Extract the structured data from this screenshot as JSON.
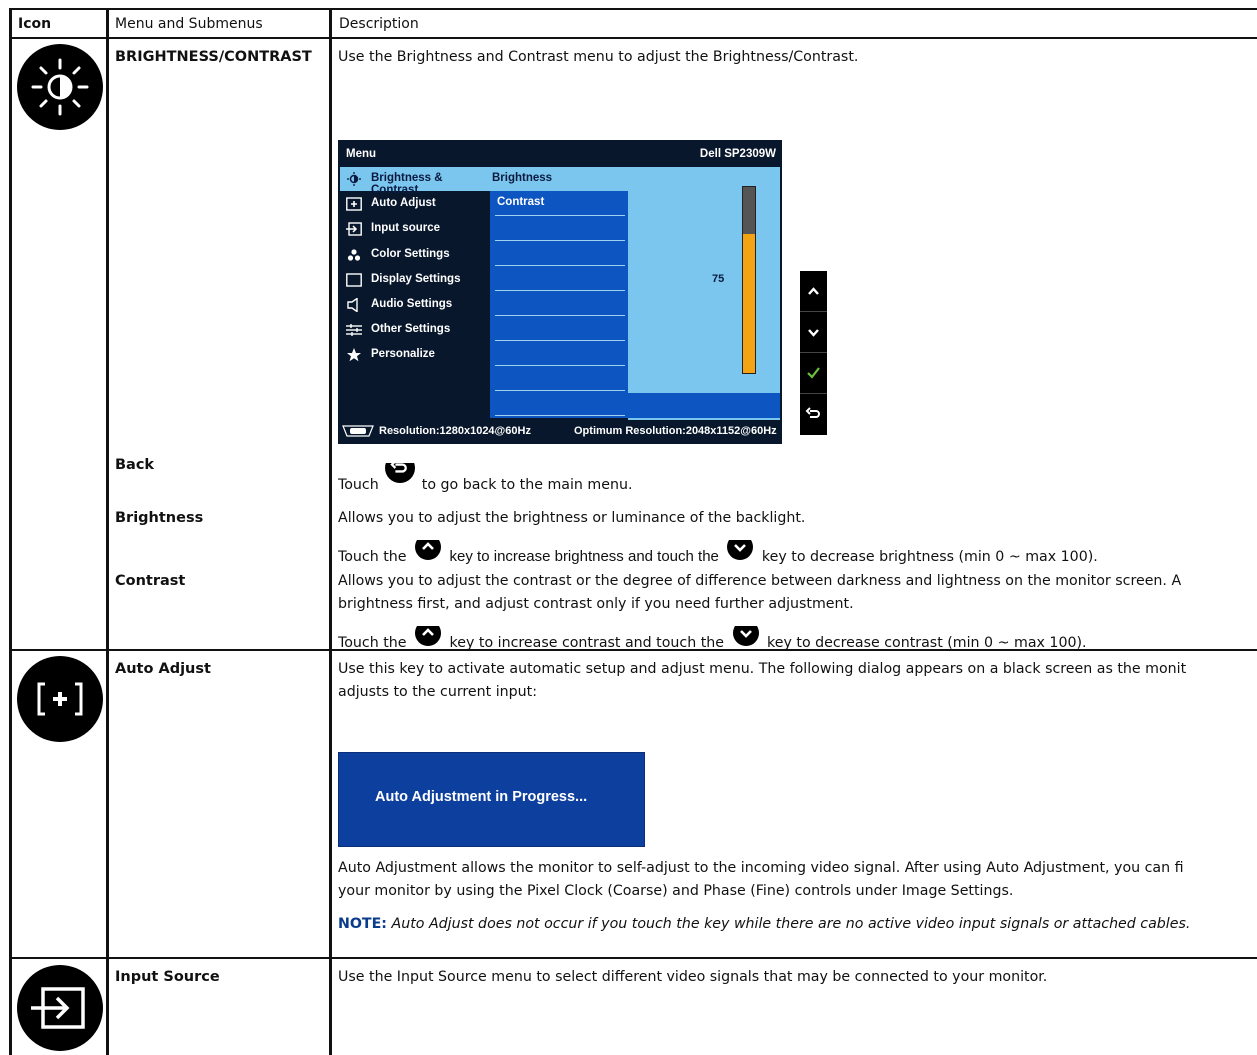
{
  "headers": {
    "icon": "Icon",
    "menu": "Menu and Submenus",
    "description": "Description"
  },
  "brightness_contrast": {
    "name": "BRIGHTNESS/CONTRAST",
    "description": "Use the Brightness and Contrast menu to adjust the Brightness/Contrast.",
    "icon": "sun-icon"
  },
  "osd": {
    "title": "Menu",
    "model": "Dell SP2309W",
    "items": [
      {
        "label": "Brightness & Contrast",
        "icon": "sun-icon"
      },
      {
        "label": "Auto Adjust",
        "icon": "auto-adjust-icon"
      },
      {
        "label": "Input source",
        "icon": "input-source-icon"
      },
      {
        "label": "Color Settings",
        "icon": "color-settings-icon"
      },
      {
        "label": "Display Settings",
        "icon": "display-settings-icon"
      },
      {
        "label": "Audio Settings",
        "icon": "speaker-icon"
      },
      {
        "label": "Other Settings",
        "icon": "sliders-icon"
      },
      {
        "label": "Personalize",
        "icon": "star-icon"
      }
    ],
    "submenu": [
      "Brightness",
      "Contrast"
    ],
    "value": 75,
    "value_max": 100,
    "resolution": "Resolution:1280x1024@60Hz",
    "optimum": "Optimum Resolution:2048x1152@60Hz",
    "side_buttons": [
      "up-arrow-icon",
      "down-arrow-icon",
      "check-icon",
      "back-icon"
    ],
    "colors": {
      "highlight": "#7ac6ee",
      "panel": "#0d55c0",
      "background": "#08172c",
      "bar_fill": "#f3a414"
    }
  },
  "back": {
    "name": "Back",
    "text_before": "Touch",
    "text_after": "to go back to the main menu."
  },
  "brightness": {
    "name": "Brightness",
    "line1": "Allows you to adjust the brightness or luminance of the backlight.",
    "line2_a": "Touch the",
    "line2_b": "key to increase brightness and touch the",
    "line2_c": "key to decrease brightness (min 0 ~ max 100)."
  },
  "contrast": {
    "name": "Contrast",
    "line1": "Allows you to adjust the contrast or the degree of difference between darkness and lightness on the monitor screen. A",
    "line2": "brightness first, and adjust contrast only if you need further adjustment.",
    "line3_a": "Touch the",
    "line3_b": "key to increase contrast and touch the",
    "line3_c": "key to decrease contrast (min 0 ~ max 100)."
  },
  "auto_adjust": {
    "name": "Auto Adjust",
    "icon": "auto-adjust-icon",
    "line1": "Use this key to activate automatic setup and adjust menu. The following dialog appears on a black screen as the monit",
    "line2": "adjusts to the current input:",
    "dialog": "Auto Adjustment in Progress...",
    "para1": "Auto Adjustment allows the monitor to self-adjust to the incoming video signal. After using Auto Adjustment, you can fi",
    "para2": "your monitor by using the Pixel Clock (Coarse) and Phase (Fine) controls under Image Settings.",
    "note_label": "NOTE:",
    "note_text": "Auto Adjust does not occur if you touch the key while there are no active video input signals or attached cables."
  },
  "input_source": {
    "name": "Input Source",
    "icon": "input-source-icon",
    "description": "Use the Input Source menu to select different video signals that may be connected to your monitor."
  }
}
